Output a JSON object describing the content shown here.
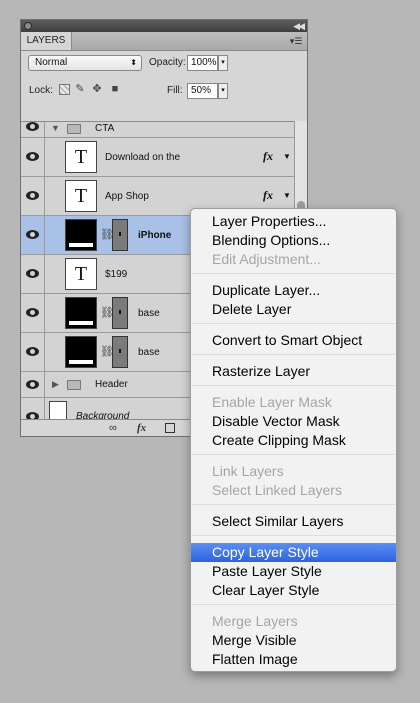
{
  "panel": {
    "tab": "LAYERS",
    "blend_mode": "Normal",
    "opacity_label": "Opacity:",
    "opacity_value": "100%",
    "lock_label": "Lock:",
    "fill_label": "Fill:",
    "fill_value": "50%"
  },
  "layers": {
    "cta": "CTA",
    "download": "Download on the",
    "appshop": "App Shop",
    "iphone": "iPhone",
    "price": "$199",
    "base1": "base",
    "base2": "base",
    "header": "Header",
    "background": "Background",
    "text_glyph": "T",
    "fx": "fx"
  },
  "menu": {
    "layer_properties": "Layer Properties...",
    "blending_options": "Blending Options...",
    "edit_adjustment": "Edit Adjustment...",
    "duplicate_layer": "Duplicate Layer...",
    "delete_layer": "Delete Layer",
    "convert_smart": "Convert to Smart Object",
    "rasterize": "Rasterize Layer",
    "enable_mask": "Enable Layer Mask",
    "disable_vector": "Disable Vector Mask",
    "clipping_mask": "Create Clipping Mask",
    "link_layers": "Link Layers",
    "select_linked": "Select Linked Layers",
    "select_similar": "Select Similar Layers",
    "copy_style": "Copy Layer Style",
    "paste_style": "Paste Layer Style",
    "clear_style": "Clear Layer Style",
    "merge_layers": "Merge Layers",
    "merge_visible": "Merge Visible",
    "flatten": "Flatten Image"
  },
  "colors": {
    "selection": "#a9c1e6",
    "menu_highlight": "#2d63e0"
  }
}
